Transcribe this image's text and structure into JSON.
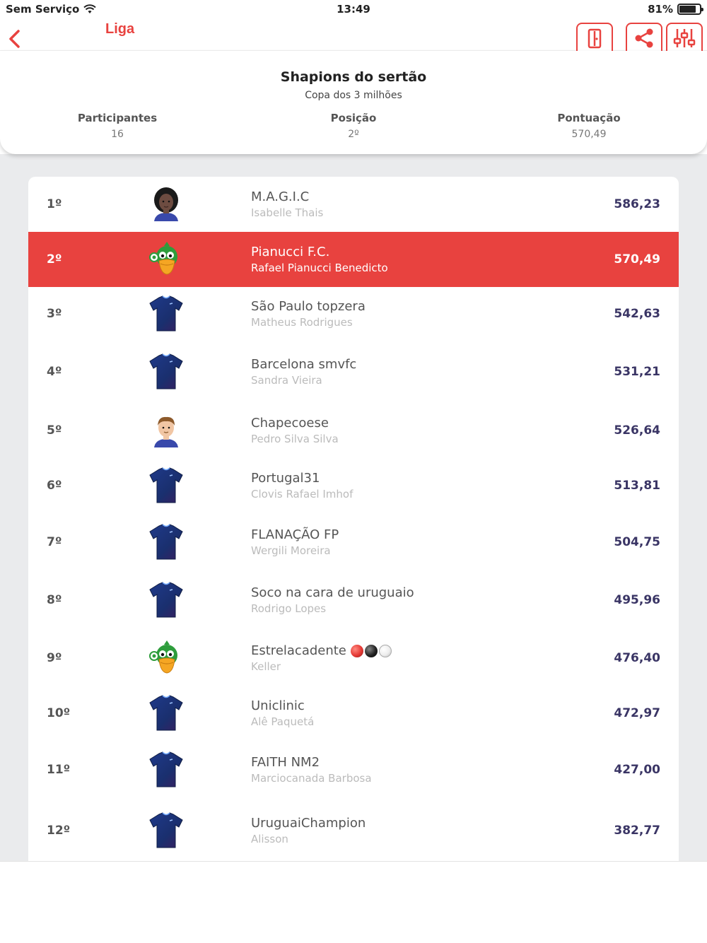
{
  "status_bar": {
    "carrier": "Sem Serviço",
    "time": "13:49",
    "battery": "81%",
    "battery_level": 0.81
  },
  "nav": {
    "title": "Liga",
    "icons": [
      "chevron-left-icon",
      "exit-door-icon",
      "share-icon",
      "filter-sliders-icon"
    ]
  },
  "league": {
    "name": "Shapions do sertão",
    "competition": "Copa dos 3 milhões",
    "stats": [
      {
        "label": "Participantes",
        "value": "16"
      },
      {
        "label": "Posição",
        "value": "2º"
      },
      {
        "label": "Pontuação",
        "value": "570,49"
      }
    ]
  },
  "colors": {
    "accent": "#e8423f",
    "score": "#3a3565",
    "background": "#eaebed"
  },
  "ranking": [
    {
      "position": "1º",
      "team": "M.A.G.I.C",
      "owner": "Isabelle Thais",
      "score": "586,23",
      "avatar": "woman-avatar-icon"
    },
    {
      "position": "2º",
      "team": "Pianucci F.C.",
      "owner": "Rafael Pianucci Benedicto",
      "score": "570,49",
      "avatar": "duck-mascot-icon",
      "highlight": true
    },
    {
      "position": "3º",
      "team": "São Paulo topzera",
      "owner": "Matheus Rodrigues",
      "score": "542,63",
      "avatar": "jersey-icon"
    },
    {
      "position": "4º",
      "team": "Barcelona smvfc",
      "owner": "Sandra Vieira",
      "score": "531,21",
      "avatar": "jersey-icon"
    },
    {
      "position": "5º",
      "team": "Chapecoese",
      "owner": "Pedro Silva Silva",
      "score": "526,64",
      "avatar": "man-avatar-icon"
    },
    {
      "position": "6º",
      "team": "Portugal31",
      "owner": "Clovis Rafael Imhof",
      "score": "513,81",
      "avatar": "jersey-icon"
    },
    {
      "position": "7º",
      "team": "FLANAÇÃO FP",
      "owner": "Wergili Moreira",
      "score": "504,75",
      "avatar": "jersey-icon"
    },
    {
      "position": "8º",
      "team": "Soco na cara de uruguaio",
      "owner": "Rodrigo Lopes",
      "score": "495,96",
      "avatar": "jersey-icon"
    },
    {
      "position": "9º",
      "team": "Estrelacadente",
      "owner": "Keller",
      "score": "476,40",
      "avatar": "duck-mascot-icon",
      "badges": [
        "red",
        "black",
        "white"
      ]
    },
    {
      "position": "10º",
      "team": "Uniclinic",
      "owner": "Alê Paquetá",
      "score": "472,97",
      "avatar": "jersey-icon"
    },
    {
      "position": "11º",
      "team": "FAITH NM2",
      "owner": "Marciocanada Barbosa",
      "score": "427,00",
      "avatar": "jersey-icon"
    },
    {
      "position": "12º",
      "team": "UruguaiChampion",
      "owner": "Alisson",
      "score": "382,77",
      "avatar": "jersey-icon"
    }
  ]
}
